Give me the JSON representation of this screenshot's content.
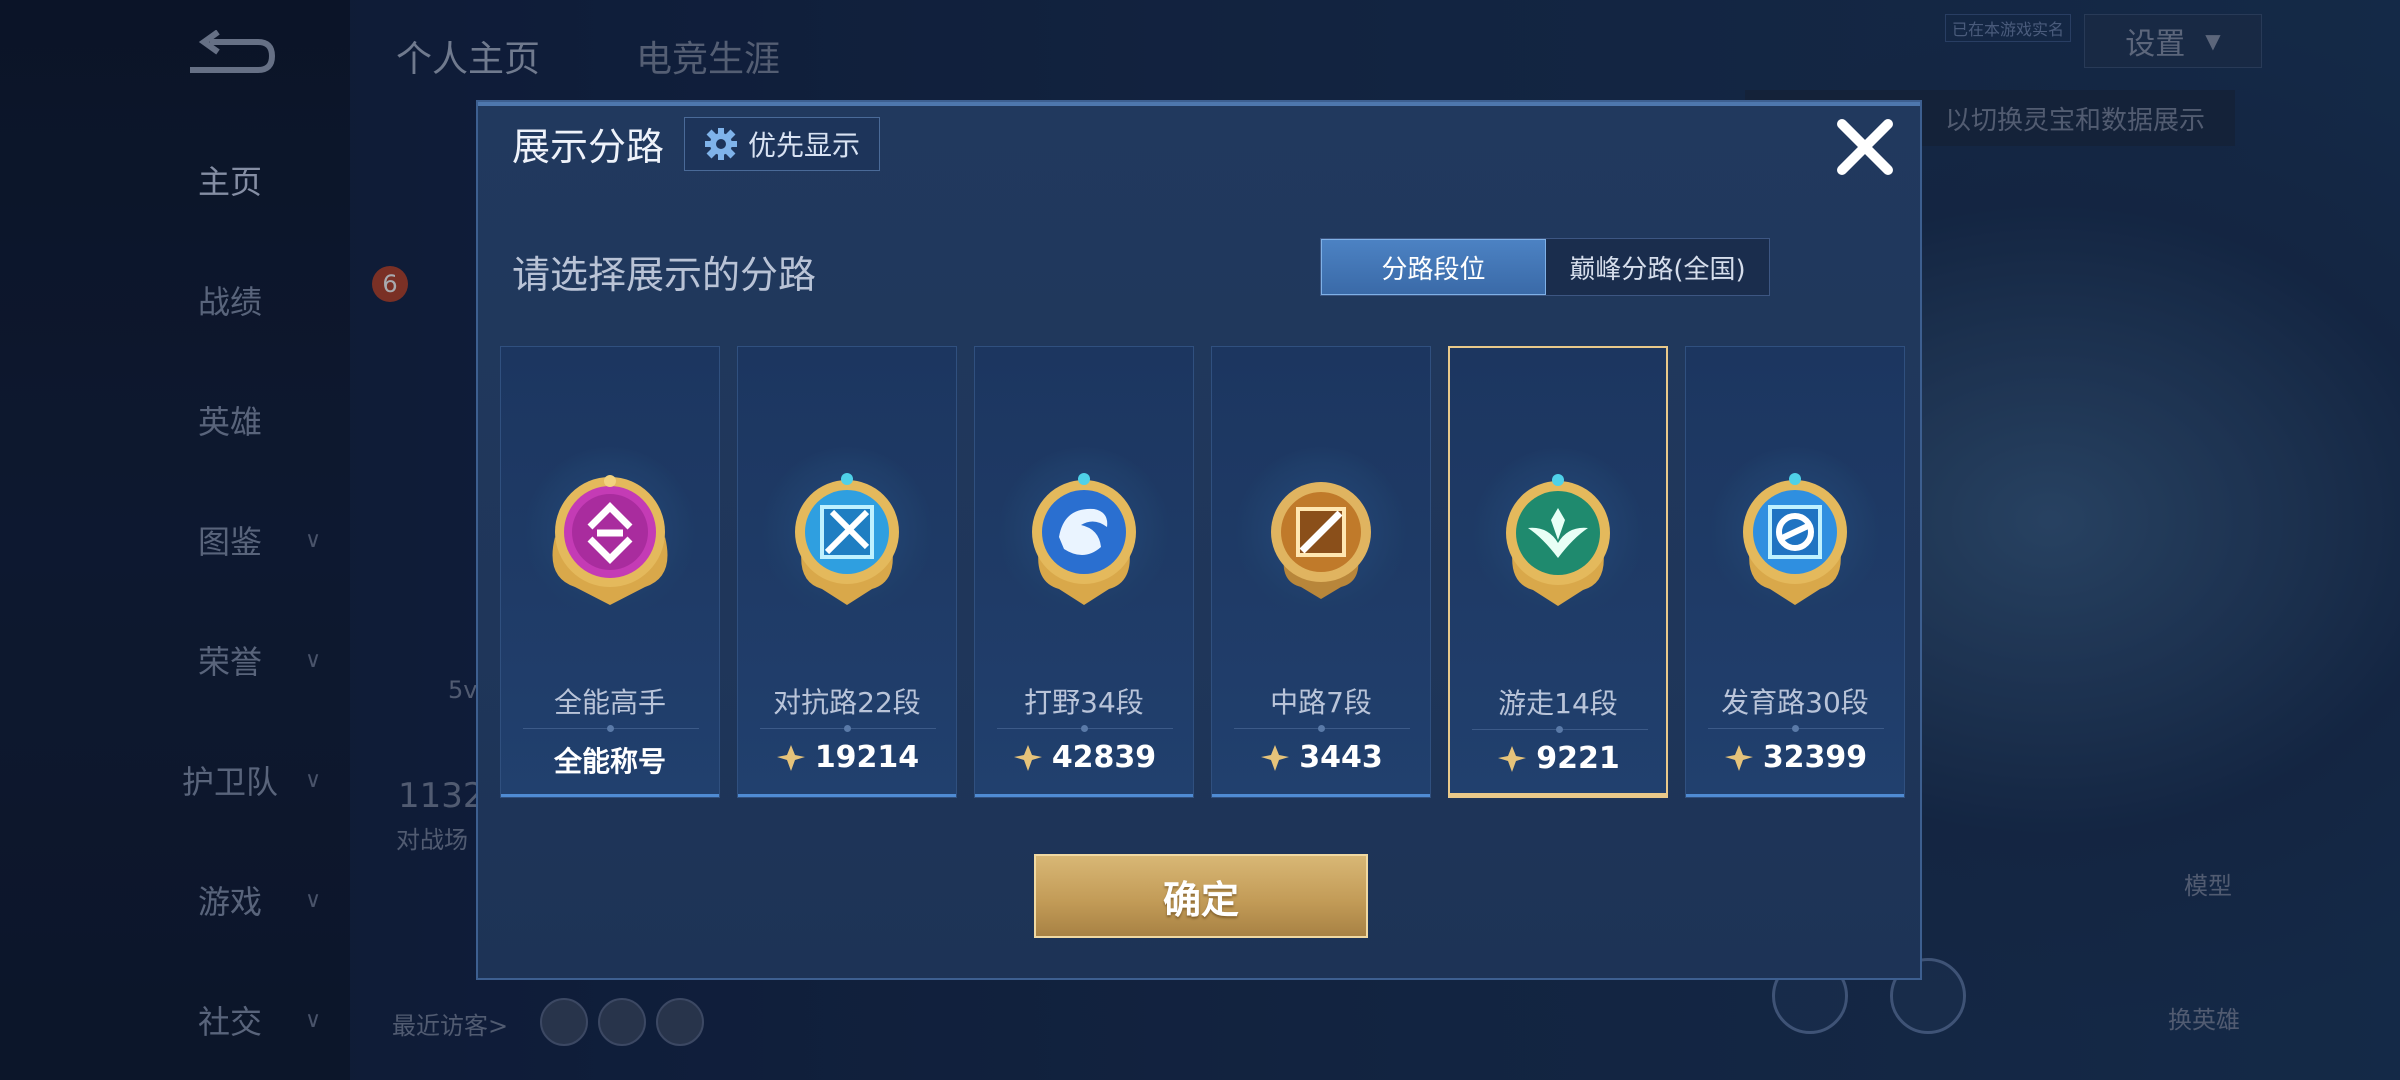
{
  "background": {
    "top_tabs": [
      "个人主页",
      "电竞生涯"
    ],
    "settings_label": "设置",
    "hint_text": "以切换灵宝和数据展示",
    "tag_text": "已在本游戏实名",
    "nav": [
      {
        "label": "主页",
        "has_chevron": false,
        "active": true
      },
      {
        "label": "战绩",
        "has_chevron": false
      },
      {
        "label": "英雄",
        "has_chevron": false
      },
      {
        "label": "图鉴",
        "has_chevron": true
      },
      {
        "label": "荣誉",
        "has_chevron": true
      },
      {
        "label": "护卫队",
        "has_chevron": true
      },
      {
        "label": "游戏",
        "has_chevron": true
      },
      {
        "label": "社交",
        "has_chevron": true
      }
    ],
    "recent_visitors_label": "最近访客>",
    "count_text": "1132",
    "count_sub": "对战场",
    "level_badge": "6",
    "side_text": "5v",
    "model_label": "模型",
    "change_hero_label": "换英雄"
  },
  "modal": {
    "title": "展示分路",
    "priority_label": "优先显示",
    "subtitle": "请选择展示的分路",
    "segments": [
      {
        "label": "分路段位",
        "active": true
      },
      {
        "label": "巅峰分路(全国)",
        "active": false
      }
    ],
    "cards": [
      {
        "label": "全能高手",
        "value": "全能称号",
        "has_icon": false,
        "color": "#c43bb5",
        "selected": false
      },
      {
        "label": "对抗路22段",
        "value": "19214",
        "has_icon": true,
        "color": "#2f9fe0",
        "selected": false
      },
      {
        "label": "打野34段",
        "value": "42839",
        "has_icon": true,
        "color": "#2a6fd0",
        "selected": false
      },
      {
        "label": "中路7段",
        "value": "3443",
        "has_icon": true,
        "color": "#c07a2a",
        "selected": false
      },
      {
        "label": "游走14段",
        "value": "9221",
        "has_icon": true,
        "color": "#1f8a6e",
        "selected": true
      },
      {
        "label": "发育路30段",
        "value": "32399",
        "has_icon": true,
        "color": "#2f8fe0",
        "selected": false
      }
    ],
    "confirm_label": "确定"
  }
}
